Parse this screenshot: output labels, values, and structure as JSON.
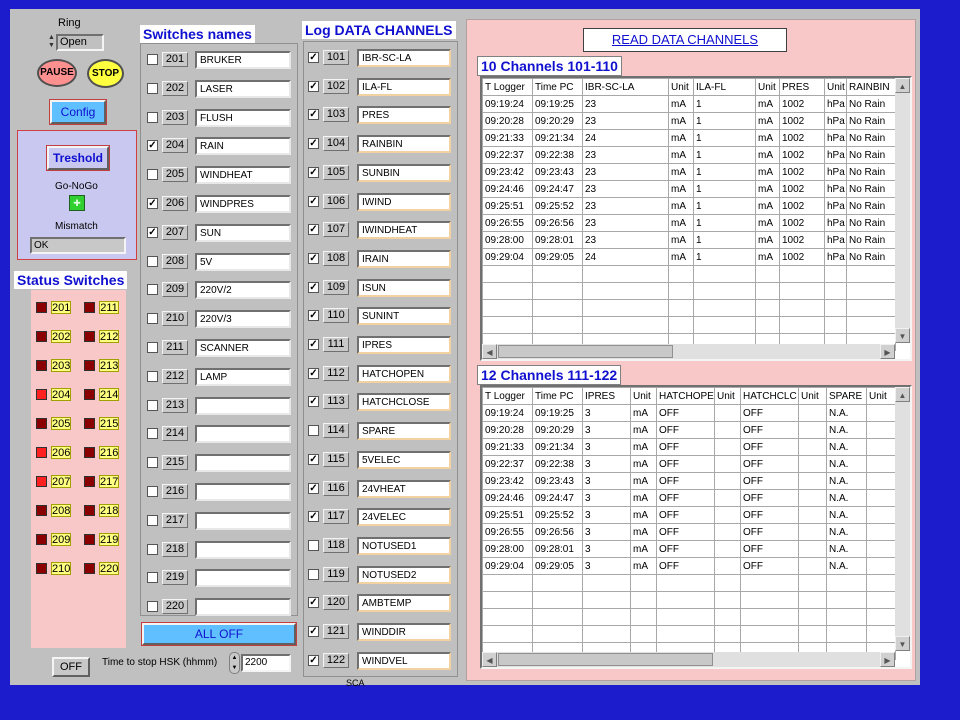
{
  "left_panel": {
    "ring_label": "Ring",
    "ring_value": "Open",
    "pause_label": "PAUSE",
    "stop_label": "STOP",
    "config_label": "Config",
    "treshold_label": "Treshold",
    "gonogo_label": "Go-NoGo",
    "mismatch_label": "Mismatch",
    "mismatch_value": "OK",
    "status_title": "Status Switches",
    "off_label": "OFF",
    "time_stop_label": "Time to stop HSK (hhmm)",
    "time_stop_value": "2200"
  },
  "status_switches": [
    {
      "label": "201",
      "state": "off"
    },
    {
      "label": "211",
      "state": "off"
    },
    {
      "label": "202",
      "state": "off"
    },
    {
      "label": "212",
      "state": "off"
    },
    {
      "label": "203",
      "state": "off"
    },
    {
      "label": "213",
      "state": "off"
    },
    {
      "label": "204",
      "state": "on"
    },
    {
      "label": "214",
      "state": "off"
    },
    {
      "label": "205",
      "state": "off"
    },
    {
      "label": "215",
      "state": "off"
    },
    {
      "label": "206",
      "state": "on"
    },
    {
      "label": "216",
      "state": "off"
    },
    {
      "label": "207",
      "state": "on"
    },
    {
      "label": "217",
      "state": "off"
    },
    {
      "label": "208",
      "state": "off"
    },
    {
      "label": "218",
      "state": "off"
    },
    {
      "label": "209",
      "state": "off"
    },
    {
      "label": "219",
      "state": "off"
    },
    {
      "label": "210",
      "state": "off"
    },
    {
      "label": "220",
      "state": "off"
    }
  ],
  "switches": {
    "title": "Switches names",
    "all_off_label": "ALL OFF",
    "items": [
      {
        "num": "201",
        "checked": false,
        "name": "BRUKER"
      },
      {
        "num": "202",
        "checked": false,
        "name": "LASER"
      },
      {
        "num": "203",
        "checked": false,
        "name": "FLUSH"
      },
      {
        "num": "204",
        "checked": true,
        "name": "RAIN"
      },
      {
        "num": "205",
        "checked": false,
        "name": "WINDHEAT"
      },
      {
        "num": "206",
        "checked": true,
        "name": "WINDPRES"
      },
      {
        "num": "207",
        "checked": true,
        "name": "SUN"
      },
      {
        "num": "208",
        "checked": false,
        "name": "5V"
      },
      {
        "num": "209",
        "checked": false,
        "name": "220V/2"
      },
      {
        "num": "210",
        "checked": false,
        "name": "220V/3"
      },
      {
        "num": "211",
        "checked": false,
        "name": "SCANNER"
      },
      {
        "num": "212",
        "checked": false,
        "name": "LAMP"
      },
      {
        "num": "213",
        "checked": false,
        "name": ""
      },
      {
        "num": "214",
        "checked": false,
        "name": ""
      },
      {
        "num": "215",
        "checked": false,
        "name": ""
      },
      {
        "num": "216",
        "checked": false,
        "name": ""
      },
      {
        "num": "217",
        "checked": false,
        "name": ""
      },
      {
        "num": "218",
        "checked": false,
        "name": ""
      },
      {
        "num": "219",
        "checked": false,
        "name": ""
      },
      {
        "num": "220",
        "checked": false,
        "name": ""
      }
    ]
  },
  "log_channels": {
    "title": "Log DATA CHANNELS",
    "footer": "SCA",
    "items": [
      {
        "num": "101",
        "checked": true,
        "name": "IBR-SC-LA"
      },
      {
        "num": "102",
        "checked": true,
        "name": "ILA-FL"
      },
      {
        "num": "103",
        "checked": true,
        "name": "PRES"
      },
      {
        "num": "104",
        "checked": true,
        "name": "RAINBIN"
      },
      {
        "num": "105",
        "checked": true,
        "name": "SUNBIN"
      },
      {
        "num": "106",
        "checked": true,
        "name": "IWIND"
      },
      {
        "num": "107",
        "checked": true,
        "name": "IWINDHEAT"
      },
      {
        "num": "108",
        "checked": true,
        "name": "IRAIN"
      },
      {
        "num": "109",
        "checked": true,
        "name": "ISUN"
      },
      {
        "num": "110",
        "checked": true,
        "name": "SUNINT"
      },
      {
        "num": "111",
        "checked": true,
        "name": "IPRES"
      },
      {
        "num": "112",
        "checked": true,
        "name": "HATCHOPEN"
      },
      {
        "num": "113",
        "checked": true,
        "name": "HATCHCLOSE"
      },
      {
        "num": "114",
        "checked": false,
        "name": "SPARE"
      },
      {
        "num": "115",
        "checked": true,
        "name": "5VELEC"
      },
      {
        "num": "116",
        "checked": true,
        "name": "24VHEAT"
      },
      {
        "num": "117",
        "checked": true,
        "name": "24VELEC"
      },
      {
        "num": "118",
        "checked": false,
        "name": "NOTUSED1"
      },
      {
        "num": "119",
        "checked": false,
        "name": "NOTUSED2"
      },
      {
        "num": "120",
        "checked": true,
        "name": "AMBTEMP"
      },
      {
        "num": "121",
        "checked": true,
        "name": "WINDDIR"
      },
      {
        "num": "122",
        "checked": true,
        "name": "WINDVEL"
      }
    ]
  },
  "read_panel": {
    "button_label": "READ DATA CHANNELS",
    "table1_title": "10 Channels 101-110",
    "table2_title": "12 Channels 111-122"
  },
  "table1": {
    "headers": [
      "T Logger",
      "Time PC",
      "IBR-SC-LA",
      "Unit",
      "ILA-FL",
      "Unit",
      "PRES",
      "Unit",
      "RAINBIN"
    ],
    "rows": [
      [
        "09:19:24",
        "09:19:25",
        "23",
        "mA",
        "1",
        "mA",
        "1002",
        "hPa",
        "No Rain"
      ],
      [
        "09:20:28",
        "09:20:29",
        "23",
        "mA",
        "1",
        "mA",
        "1002",
        "hPa",
        "No Rain"
      ],
      [
        "09:21:33",
        "09:21:34",
        "24",
        "mA",
        "1",
        "mA",
        "1002",
        "hPa",
        "No Rain"
      ],
      [
        "09:22:37",
        "09:22:38",
        "23",
        "mA",
        "1",
        "mA",
        "1002",
        "hPa",
        "No Rain"
      ],
      [
        "09:23:42",
        "09:23:43",
        "23",
        "mA",
        "1",
        "mA",
        "1002",
        "hPa",
        "No Rain"
      ],
      [
        "09:24:46",
        "09:24:47",
        "23",
        "mA",
        "1",
        "mA",
        "1002",
        "hPa",
        "No Rain"
      ],
      [
        "09:25:51",
        "09:25:52",
        "23",
        "mA",
        "1",
        "mA",
        "1002",
        "hPa",
        "No Rain"
      ],
      [
        "09:26:55",
        "09:26:56",
        "23",
        "mA",
        "1",
        "mA",
        "1002",
        "hPa",
        "No Rain"
      ],
      [
        "09:28:00",
        "09:28:01",
        "23",
        "mA",
        "1",
        "mA",
        "1002",
        "hPa",
        "No Rain"
      ],
      [
        "09:29:04",
        "09:29:05",
        "24",
        "mA",
        "1",
        "mA",
        "1002",
        "hPa",
        "No Rain"
      ]
    ]
  },
  "table2": {
    "headers": [
      "T Logger",
      "Time PC",
      "IPRES",
      "Unit",
      "HATCHOPE",
      "Unit",
      "HATCHCLC",
      "Unit",
      "SPARE",
      "Unit"
    ],
    "rows": [
      [
        "09:19:24",
        "09:19:25",
        "3",
        "mA",
        "OFF",
        "",
        "OFF",
        "",
        "N.A.",
        ""
      ],
      [
        "09:20:28",
        "09:20:29",
        "3",
        "mA",
        "OFF",
        "",
        "OFF",
        "",
        "N.A.",
        ""
      ],
      [
        "09:21:33",
        "09:21:34",
        "3",
        "mA",
        "OFF",
        "",
        "OFF",
        "",
        "N.A.",
        ""
      ],
      [
        "09:22:37",
        "09:22:38",
        "3",
        "mA",
        "OFF",
        "",
        "OFF",
        "",
        "N.A.",
        ""
      ],
      [
        "09:23:42",
        "09:23:43",
        "3",
        "mA",
        "OFF",
        "",
        "OFF",
        "",
        "N.A.",
        ""
      ],
      [
        "09:24:46",
        "09:24:47",
        "3",
        "mA",
        "OFF",
        "",
        "OFF",
        "",
        "N.A.",
        ""
      ],
      [
        "09:25:51",
        "09:25:52",
        "3",
        "mA",
        "OFF",
        "",
        "OFF",
        "",
        "N.A.",
        ""
      ],
      [
        "09:26:55",
        "09:26:56",
        "3",
        "mA",
        "OFF",
        "",
        "OFF",
        "",
        "N.A.",
        ""
      ],
      [
        "09:28:00",
        "09:28:01",
        "3",
        "mA",
        "OFF",
        "",
        "OFF",
        "",
        "N.A.",
        ""
      ],
      [
        "09:29:04",
        "09:29:05",
        "3",
        "mA",
        "OFF",
        "",
        "OFF",
        "",
        "N.A.",
        ""
      ]
    ]
  },
  "colors": {
    "background_blue": "#1c1ccc",
    "panel_pink": "#f8c8c8",
    "led_on": "#ff2020",
    "led_off": "#8a0000",
    "title_blue": "#1010d0",
    "all_off_bg": "#60c0ff",
    "gonogo_green": "#30d030"
  }
}
